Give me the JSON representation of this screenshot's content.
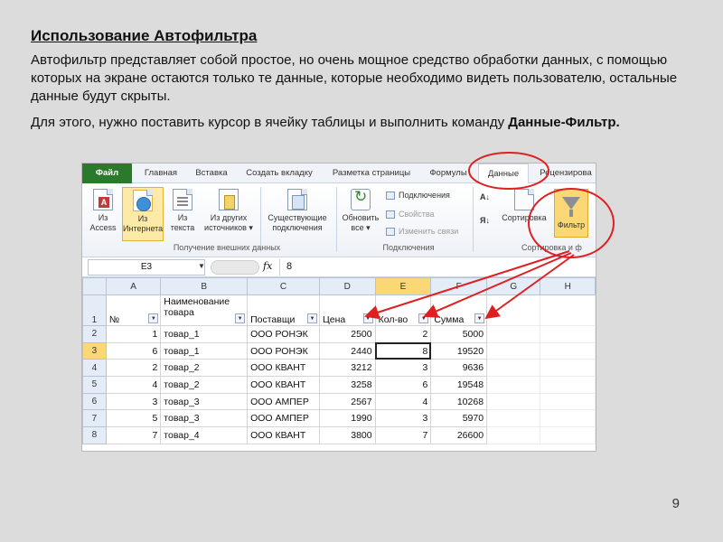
{
  "slide": {
    "title": "Использование Автофильтра",
    "para1": "Автофильтр представляет собой простое, но очень мощное средство обработки данных, с помощью которых на экране остаются только те данные, которые необходимо видеть пользователю, остальные данные будут скрыты.",
    "para2_plain": "Для этого, нужно поставить курсор в ячейку таблицы и выполнить команду ",
    "para2_bold": "Данные-Фильтр.",
    "page_number": "9"
  },
  "excel": {
    "tabs": [
      {
        "label": "Файл"
      },
      {
        "label": "Главная"
      },
      {
        "label": "Вставка"
      },
      {
        "label": "Создать вкладку"
      },
      {
        "label": "Разметка страницы"
      },
      {
        "label": "Формулы"
      },
      {
        "label": "Данные"
      },
      {
        "label": "Рецензирова"
      }
    ],
    "ribbon": {
      "from_access": "Из\nAccess",
      "from_web": "Из\nИнтернета",
      "from_text": "Из\nтекста",
      "from_other": "Из других\nисточников ▾",
      "existing": "Существующие\nподключения",
      "refresh_all": "Обновить\nвсе ▾",
      "connections": "Подключения",
      "properties": "Свойства",
      "edit_links": "Изменить связи",
      "sort": "Сортировка",
      "filter": "Фильтр",
      "group_external": "Получение внешних данных",
      "group_connections": "Подключения",
      "group_sort": "Сортировка и ф"
    },
    "formula_bar": {
      "name_box": "E3",
      "fx": "fx",
      "value": "8"
    },
    "columns": [
      "A",
      "B",
      "C",
      "D",
      "E",
      "F",
      "G",
      "H"
    ],
    "header_row": [
      "№",
      "Наименование товара",
      "Поставщи",
      "Цена",
      "Кол-во",
      "Сумма"
    ],
    "rows": [
      [
        "1",
        "товар_1",
        "ООО РОНЭК",
        "2500",
        "2",
        "5000"
      ],
      [
        "6",
        "товар_1",
        "ООО РОНЭК",
        "2440",
        "8",
        "19520"
      ],
      [
        "2",
        "товар_2",
        "ООО КВАНТ",
        "3212",
        "3",
        "9636"
      ],
      [
        "4",
        "товар_2",
        "ООО КВАНТ",
        "3258",
        "6",
        "19548"
      ],
      [
        "3",
        "товар_3",
        "ООО АМПЕР",
        "2567",
        "4",
        "10268"
      ],
      [
        "5",
        "товар_3",
        "ООО АМПЕР",
        "1990",
        "3",
        "5970"
      ],
      [
        "7",
        "товар_4",
        "ООО КВАНТ",
        "3800",
        "7",
        "26600"
      ]
    ],
    "row_numbers": [
      "1",
      "2",
      "3",
      "4",
      "5",
      "6",
      "7",
      "8"
    ],
    "annotation_color": "#e02020",
    "accent_file_tab": "#2b7a2b",
    "selection_color": "#fbd775"
  }
}
